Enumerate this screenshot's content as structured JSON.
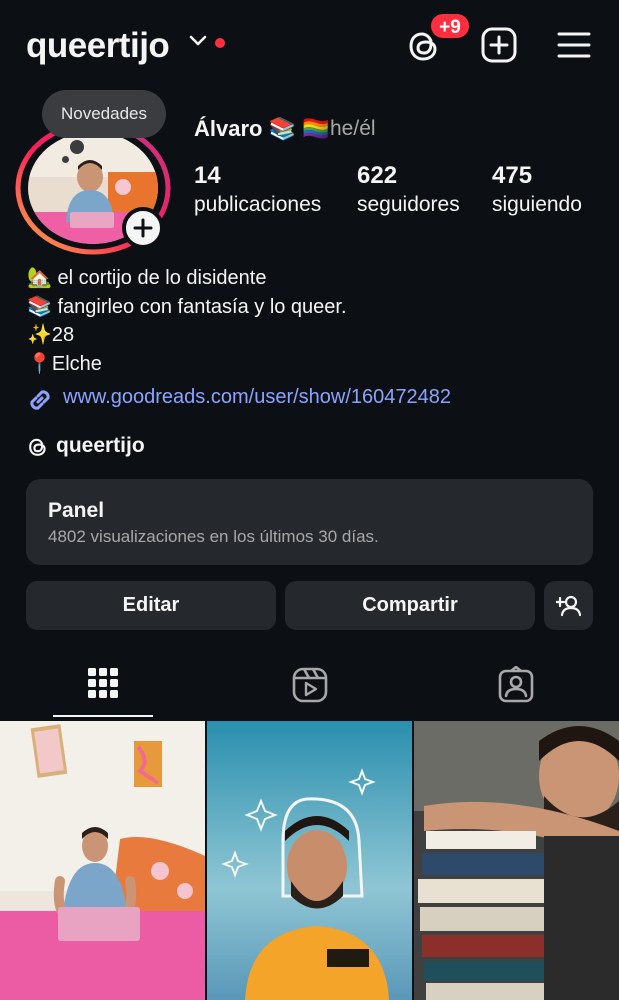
{
  "header": {
    "username": "queertijo",
    "notification_badge": "+9",
    "icons": [
      "chevron-down-icon",
      "threads-icon",
      "create-icon",
      "menu-icon"
    ]
  },
  "avatar": {
    "notes_label": "Novedades"
  },
  "profile": {
    "display_name": "Álvaro 📚 🏳️‍🌈",
    "pronouns": "he/él",
    "stats": [
      {
        "value": "14",
        "label": "publicaciones"
      },
      {
        "value": "622",
        "label": "seguidores"
      },
      {
        "value": "475",
        "label": "siguiendo"
      }
    ]
  },
  "bio": {
    "lines": [
      "🏡 el cortijo de lo disidente",
      "📚 fangirleo con fantasía y lo queer.",
      "✨28",
      "📍Elche"
    ],
    "link": "www.goodreads.com/user/show/160472482",
    "threads_handle": "queertijo"
  },
  "panel": {
    "title": "Panel",
    "subtitle": "4802 visualizaciones en los últimos 30 días."
  },
  "actions": {
    "edit": "Editar",
    "share": "Compartir"
  },
  "tabs": [
    {
      "name": "grid-icon",
      "active": true
    },
    {
      "name": "reels-icon",
      "active": false
    },
    {
      "name": "tagged-icon",
      "active": false
    }
  ],
  "grid": [
    {
      "desc": "photo-room"
    },
    {
      "desc": "photo-portrait"
    },
    {
      "desc": "photo-books"
    }
  ],
  "colors": {
    "background": "#0c1014",
    "surface": "#25292e",
    "link": "#8da3ff",
    "badge": "#ff2f40"
  }
}
